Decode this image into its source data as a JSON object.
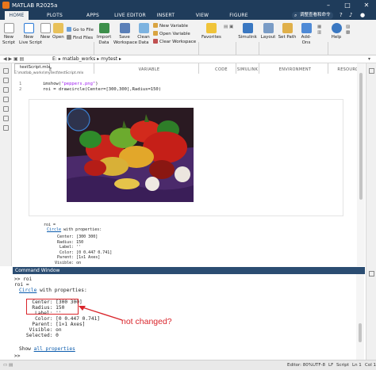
{
  "window": {
    "title": "MATLAB R2025a",
    "controls": [
      "–",
      "□",
      "✕"
    ]
  },
  "tabs": [
    "HOME",
    "PLOTS",
    "APPS",
    "LIVE EDITOR",
    "INSERT",
    "VIEW",
    "FIGURE"
  ],
  "search_placeholder": "调整查看和命令",
  "ribbon": {
    "new_script": "New\nScript",
    "new_live_script": "New\nLive Script",
    "new": "New",
    "open": "Open",
    "go_to_file": "Go to File",
    "find_files": "Find Files",
    "import_data": "Import\nData",
    "save_workspace": "Save\nWorkspace",
    "clean_data": "Clean\nData",
    "new_variable": "New Variable",
    "open_variable": "Open Variable",
    "clear_workspace": "Clear Workspace",
    "favorites": "Favorites",
    "simulink": "Simulink",
    "layout": "Layout",
    "set_path": "Set Path",
    "addons": "Add-Ons",
    "help": "Help",
    "groups": [
      "FILE",
      "VARIABLE",
      "CODE",
      "SIMULINK",
      "ENVIRONMENT",
      "RESOURCES"
    ]
  },
  "address": {
    "path": "E: ▸ matlab_works ▸ mytest ▸"
  },
  "editor": {
    "tab": "testScript.mlx",
    "path": "E:\\matlab_works\\mytest\\testScript.mlx",
    "line_numbers": [
      "1",
      "2"
    ],
    "line1_fn": "imshow(",
    "line1_str": "\"peppers.png\"",
    "line1_end": ")",
    "line2": "roi = drawcircle(Center=[300,300],Radius=150)",
    "output": {
      "roi_eq": "roi =",
      "circle_link": "Circle",
      "circle_rest": " with properties:",
      "props": "     Center: [300 300]\n     Radius: 150\n      Label: ''\n      Color: [0 0.447 0.741]\n     Parent: [1x1 Axes]\n    Visible: on"
    }
  },
  "command_window": {
    "title": "Command Window",
    "prompt1": ">> roi",
    "roi_eq": "roi =",
    "circle_link": "Circle",
    "circle_rest": " with properties:",
    "center": "      Center: [300 300]",
    "radius": "      Radius: 150",
    "rest": "       Label: ''\n       Color: [0 0.447 0.741]\n      Parent: [1×1 Axes]\n     Visible: on\n    Selected: 0",
    "show": "Show ",
    "all_props": "all properties",
    "prompt2": ">> ",
    "annotation": "not changed?"
  },
  "statusbar": {
    "editor": "Editor: 80%",
    "encoding": "UTF-8",
    "eol": "LF",
    "mode": "Script",
    "ln": "Ln 1",
    "col": "Col 1"
  },
  "colors": {
    "title_bar": "#1f3c5b",
    "command_header": "#2b4d72",
    "annotation": "#d9252b",
    "link": "#0b5cad",
    "roi_circle": "#3a7fd0"
  }
}
